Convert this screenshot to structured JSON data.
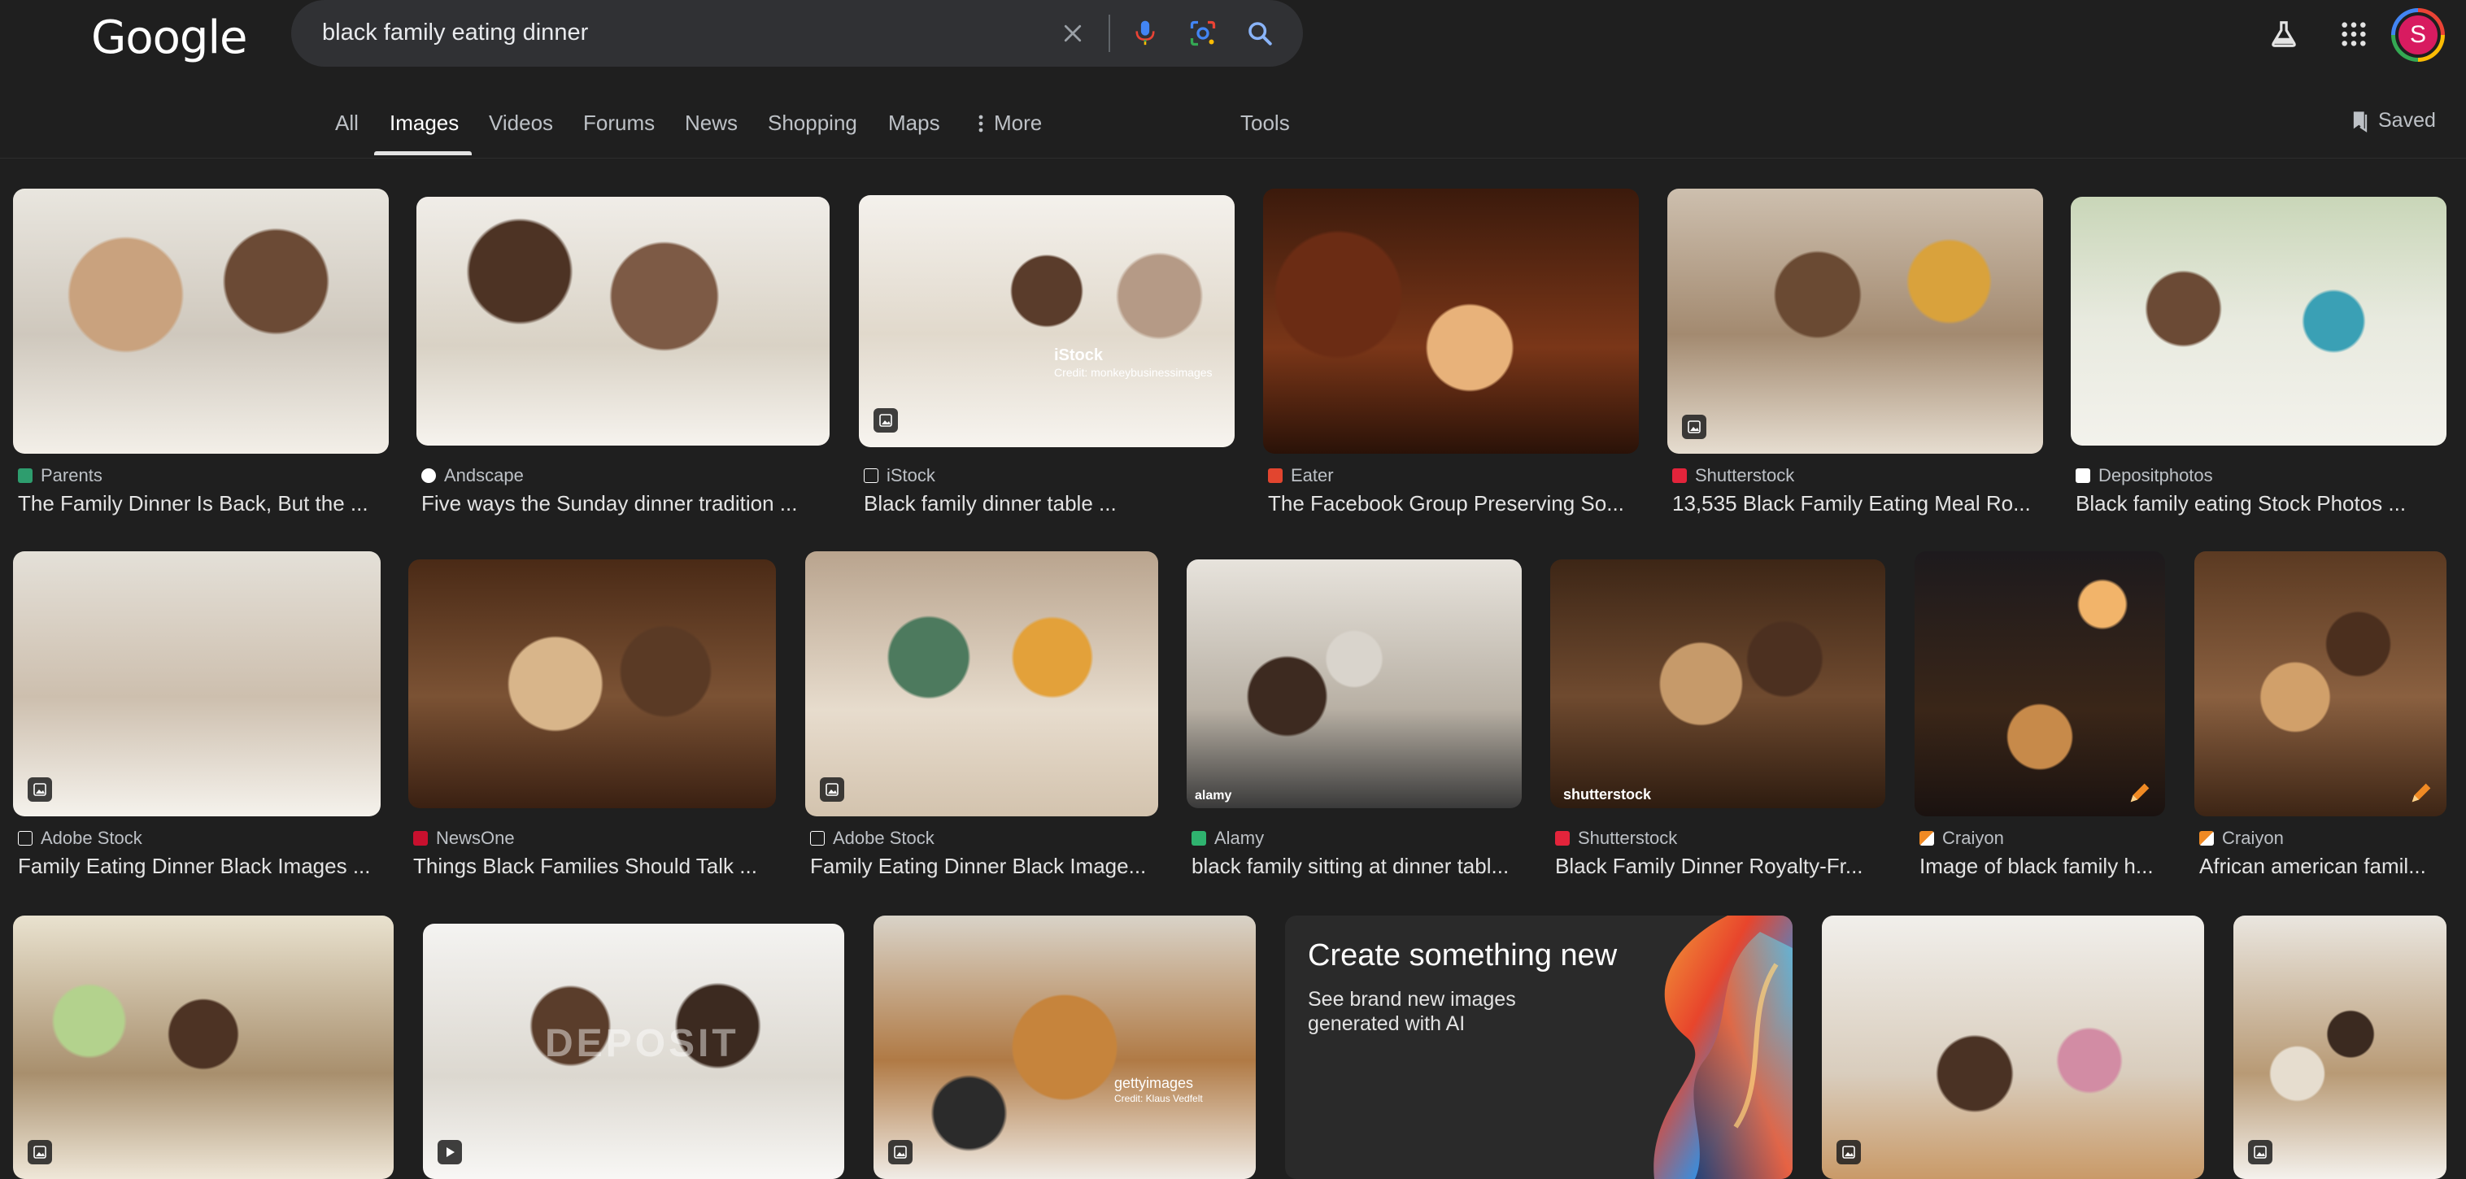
{
  "header": {
    "logo": "Google",
    "search_query": "black family eating dinner",
    "avatar_letter": "S"
  },
  "tabs": [
    {
      "label": "All"
    },
    {
      "label": "Images"
    },
    {
      "label": "Videos"
    },
    {
      "label": "Forums"
    },
    {
      "label": "News"
    },
    {
      "label": "Shopping"
    },
    {
      "label": "Maps"
    },
    {
      "label": "More"
    },
    {
      "label": "Tools"
    }
  ],
  "saved_label": "Saved",
  "results": [
    {
      "source": "Parents",
      "title": "The Family Dinner Is Back, But the ...",
      "favicon_color": "#2e9d6e"
    },
    {
      "source": "Andscape",
      "title": "Five ways the Sunday dinner tradition ...",
      "favicon_color": "#ffffff"
    },
    {
      "source": "iStock",
      "title": "Black family dinner table ...",
      "favicon_color": "#1f1f1f"
    },
    {
      "source": "Eater",
      "title": "The Facebook Group Preserving So...",
      "favicon_color": "#e2452f"
    },
    {
      "source": "Shutterstock",
      "title": "13,535 Black Family Eating Meal Ro...",
      "favicon_color": "#e3243b"
    },
    {
      "source": "Depositphotos",
      "title": "Black family eating Stock Photos ...",
      "favicon_color": "#ffffff"
    },
    {
      "source": "Adobe Stock",
      "title": "Family Eating Dinner Black Images ...",
      "favicon_color": "#1f1f1f"
    },
    {
      "source": "NewsOne",
      "title": "Things Black Families Should Talk ...",
      "favicon_color": "#c8102e"
    },
    {
      "source": "Adobe Stock",
      "title": "Family Eating Dinner Black Image...",
      "favicon_color": "#1f1f1f"
    },
    {
      "source": "Alamy",
      "title": "black family sitting at dinner tabl...",
      "favicon_color": "#2fb36f"
    },
    {
      "source": "Shutterstock",
      "title": "Black Family Dinner Royalty-Fr...",
      "favicon_color": "#e3243b"
    },
    {
      "source": "Craiyon",
      "title": "Image of black family h...",
      "favicon_color": "#f08a24"
    },
    {
      "source": "Craiyon",
      "title": "African american famil...",
      "favicon_color": "#f08a24"
    }
  ],
  "image_overlays": {
    "istock": "iStock",
    "istock_credit": "Credit: monkeybusinessimages",
    "shutterstock": "shutterstock",
    "alamy": "alamy",
    "getty": "gettyimages",
    "getty_credit": "Credit: Klaus Vedfelt",
    "depositphotos": "DEPOSIT"
  },
  "create_card": {
    "title": "Create something new",
    "subtitle": "See brand new images generated with AI"
  },
  "colors": {
    "background": "#1f1f1f",
    "searchbar": "#303134",
    "text": "#e3e3e3",
    "muted": "#bdc1c6"
  }
}
